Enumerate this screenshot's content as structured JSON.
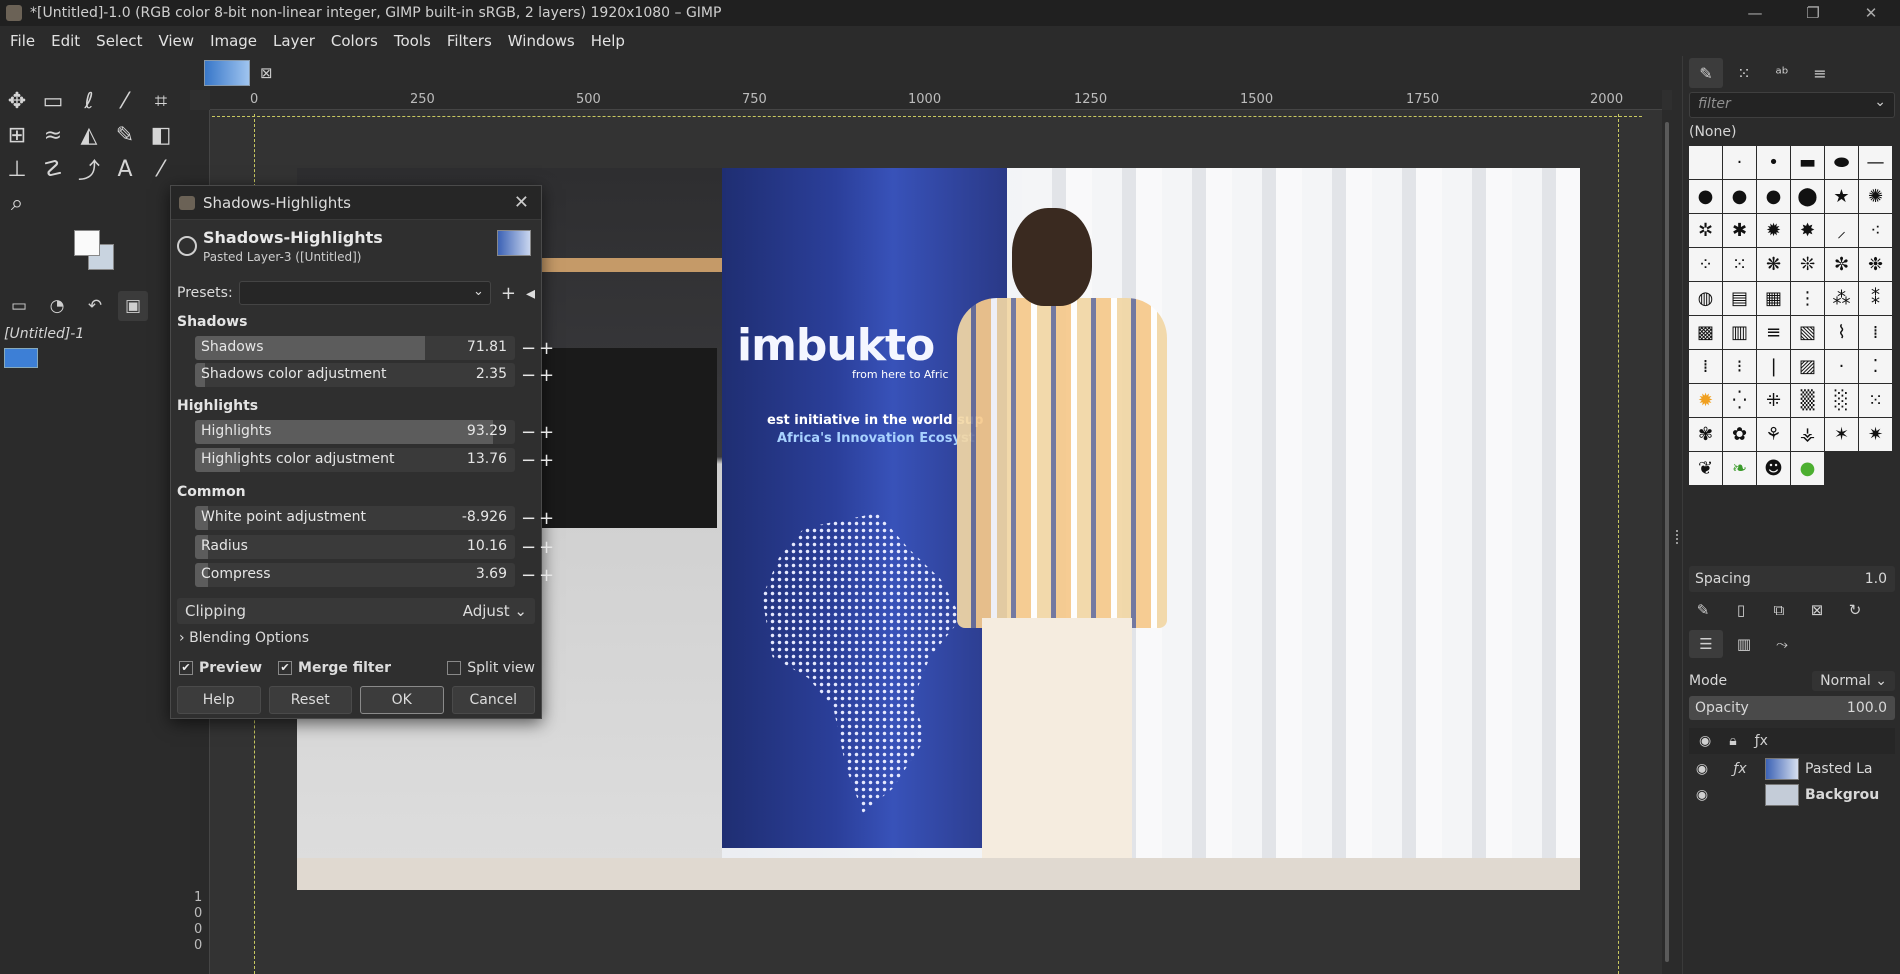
{
  "window": {
    "title": "*[Untitled]-1.0 (RGB color 8-bit non-linear integer, GIMP built-in sRGB, 2 layers) 1920x1080 – GIMP"
  },
  "menu": [
    "File",
    "Edit",
    "Select",
    "View",
    "Image",
    "Layer",
    "Colors",
    "Tools",
    "Filters",
    "Windows",
    "Help"
  ],
  "image_panel": {
    "name": "[Untitled]-1"
  },
  "ruler": {
    "h": [
      "0",
      "250",
      "500",
      "750",
      "1000",
      "1250",
      "1500",
      "1750",
      "2000"
    ],
    "v": [
      "1",
      "0",
      "0",
      "0"
    ]
  },
  "photo": {
    "banner_title": "imbukto",
    "banner_sub": "from here to Afric",
    "banner_line1": "est initiative in the world sup",
    "banner_line2": "Africa's Innovation Ecosyst"
  },
  "dialog": {
    "title": "Shadows-Highlights",
    "heading": "Shadows-Highlights",
    "subheading": "Pasted Layer-3 ([Untitled])",
    "presets_label": "Presets:",
    "sections": {
      "shadows": "Shadows",
      "highlights": "Highlights",
      "common": "Common"
    },
    "sliders": [
      {
        "label": "Shadows",
        "value": "71.81",
        "fraction": 0.72
      },
      {
        "label": "Shadows color adjustment",
        "value": "2.35",
        "fraction": 0.03
      },
      {
        "label": "Highlights",
        "value": "93.29",
        "fraction": 0.93
      },
      {
        "label": "Highlights color adjustment",
        "value": "13.76",
        "fraction": 0.14
      },
      {
        "label": "White point adjustment",
        "value": "-8.926",
        "fraction": 0.04
      },
      {
        "label": "Radius",
        "value": "10.16",
        "fraction": 0.04
      },
      {
        "label": "Compress",
        "value": "3.69",
        "fraction": 0.04
      }
    ],
    "clipping_label": "Clipping",
    "clipping_value": "Adjust",
    "blending": "Blending Options",
    "preview": "Preview",
    "merge": "Merge filter",
    "split": "Split view",
    "buttons": {
      "help": "Help",
      "reset": "Reset",
      "ok": "OK",
      "cancel": "Cancel"
    }
  },
  "right": {
    "filter_placeholder": "filter",
    "brush_name": "(None)",
    "spacing_label": "Spacing",
    "spacing_value": "1.0",
    "mode_label": "Mode",
    "mode_value": "Normal",
    "opacity_label": "Opacity",
    "opacity_value": "100.0",
    "layers": [
      {
        "name": "Pasted La"
      },
      {
        "name": "Backgrou"
      }
    ]
  }
}
